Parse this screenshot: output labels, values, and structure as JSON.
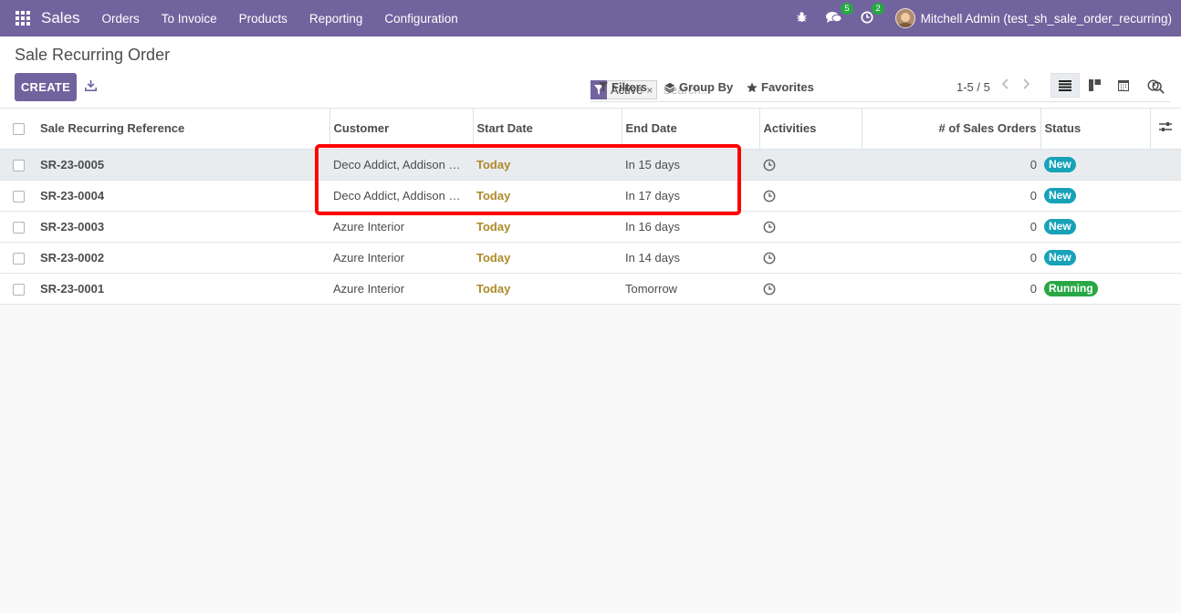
{
  "navbar": {
    "brand": "Sales",
    "menu": [
      "Orders",
      "To Invoice",
      "Products",
      "Reporting",
      "Configuration"
    ],
    "messages_count": "5",
    "activities_count": "2",
    "user": "Mitchell Admin (test_sh_sale_order_recurring)"
  },
  "control_panel": {
    "breadcrumb": "Sale Recurring Order",
    "create_label": "CREATE",
    "facet_label": "Active",
    "facet_close": "×",
    "search_placeholder": "Search...",
    "filters_label": "Filters",
    "groupby_label": "Group By",
    "favorites_label": "Favorites",
    "pager": "1-5 / 5"
  },
  "columns": [
    "Sale Recurring Reference",
    "Customer",
    "Start Date",
    "End Date",
    "Activities",
    "# of Sales Orders",
    "Status"
  ],
  "rows": [
    {
      "ref": "SR-23-0005",
      "customer": "Deco Addict, Addison Olson",
      "start": "Today",
      "end": "In 15 days",
      "orders": "0",
      "status": "New"
    },
    {
      "ref": "SR-23-0004",
      "customer": "Deco Addict, Addison Olson",
      "start": "Today",
      "end": "In 17 days",
      "orders": "0",
      "status": "New"
    },
    {
      "ref": "SR-23-0003",
      "customer": "Azure Interior",
      "start": "Today",
      "end": "In 16 days",
      "orders": "0",
      "status": "New"
    },
    {
      "ref": "SR-23-0002",
      "customer": "Azure Interior",
      "start": "Today",
      "end": "In 14 days",
      "orders": "0",
      "status": "New"
    },
    {
      "ref": "SR-23-0001",
      "customer": "Azure Interior",
      "start": "Today",
      "end": "Tomorrow",
      "orders": "0",
      "status": "Running"
    }
  ],
  "colors": {
    "brand": "#71639e",
    "new_badge": "#17a2b8",
    "running_badge": "#28a745",
    "today": "#ad8a28",
    "annotation": "#ff0000"
  }
}
